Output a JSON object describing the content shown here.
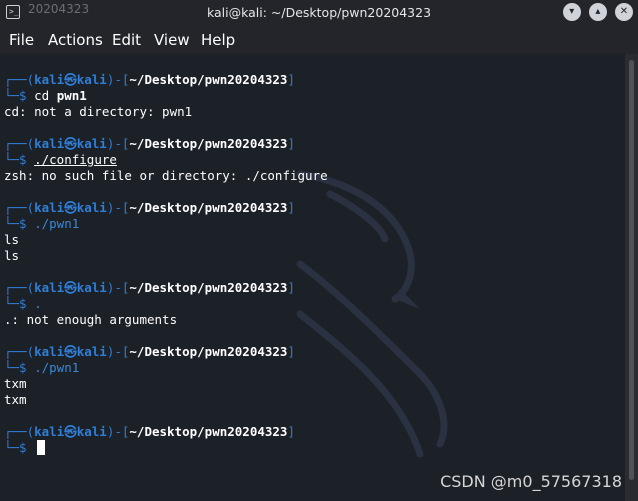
{
  "window": {
    "title": "kali@kali: ~/Desktop/pwn20204323",
    "ghost_title": "20204323"
  },
  "menu": [
    "File",
    "Actions",
    "Edit",
    "View",
    "Help"
  ],
  "prompt": {
    "open": "┌──(",
    "user": "kali㉿kali",
    "mid": ")-[",
    "cwd": "~/Desktop/pwn20204323",
    "close": "]",
    "sym": "└─$ "
  },
  "entries": [
    {
      "command": "cd ",
      "command_bold": "pwn1",
      "output": [
        "cd: not a directory: pwn1"
      ]
    },
    {
      "command_underline": "./configure",
      "output": [
        "zsh: no such file or directory: ./configure"
      ]
    },
    {
      "command_italic": "./pwn1",
      "output": [
        "ls",
        "ls"
      ]
    },
    {
      "command_italic": ".",
      "output": [
        ".: not enough arguments"
      ]
    },
    {
      "command_italic": "./pwn1",
      "output": [
        "txm",
        "txm"
      ]
    }
  ],
  "watermark": "CSDN @m0_57567318",
  "colors": {
    "prompt_blue": "#2f7fd6",
    "background": "#1c2027"
  }
}
